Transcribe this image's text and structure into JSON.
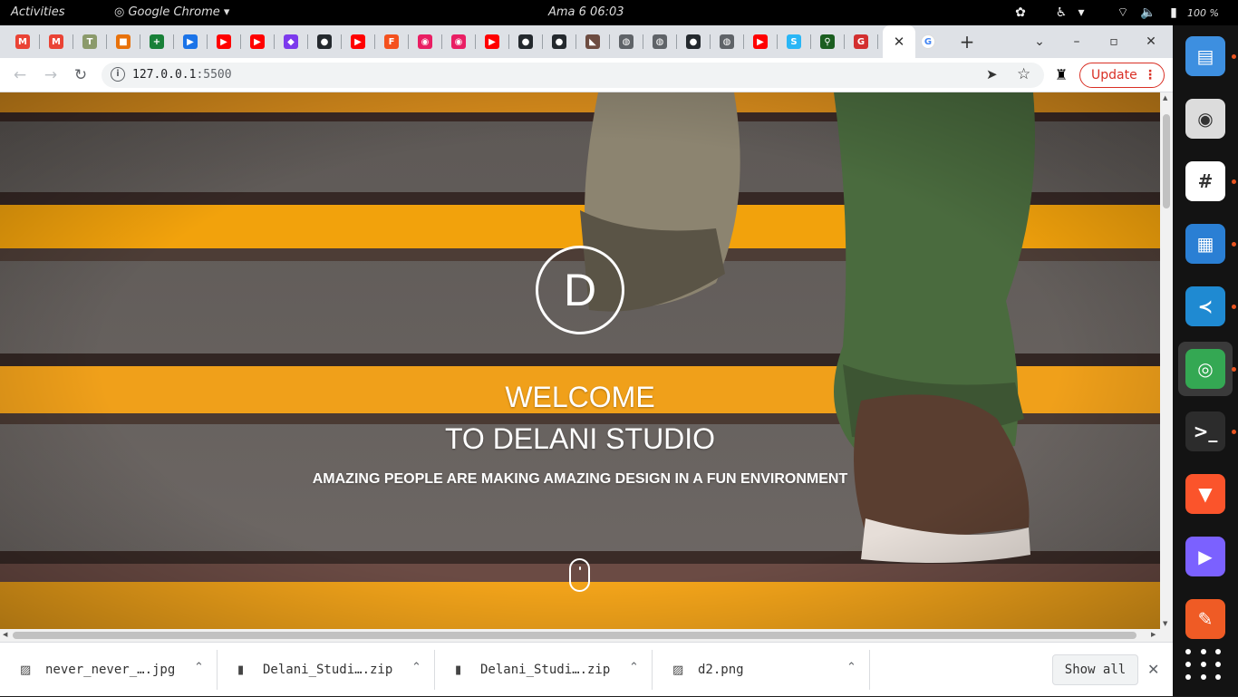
{
  "topbar": {
    "activities": "Activities",
    "app_name": "Google Chrome",
    "clock": "Ama 6 06:03",
    "battery": "100 %"
  },
  "tabs": [
    {
      "icon": "gmail-icon",
      "glyph": "M",
      "color": "#ea4335"
    },
    {
      "icon": "gmail-icon",
      "glyph": "M",
      "color": "#ea4335"
    },
    {
      "icon": "palm-icon",
      "glyph": "T",
      "color": "#8b9a6b"
    },
    {
      "icon": "puzzle-icon",
      "glyph": "■",
      "color": "#e8710a"
    },
    {
      "icon": "sheets-icon",
      "glyph": "+",
      "color": "#188038"
    },
    {
      "icon": "video-player-icon",
      "glyph": "▶",
      "color": "#1a73e8"
    },
    {
      "icon": "youtube-icon",
      "glyph": "▶",
      "color": "#ff0000"
    },
    {
      "icon": "youtube-icon",
      "glyph": "▶",
      "color": "#ff0000"
    },
    {
      "icon": "diamond-icon",
      "glyph": "◆",
      "color": "#7c3aed"
    },
    {
      "icon": "github-icon",
      "glyph": "●",
      "color": "#24292e"
    },
    {
      "icon": "youtube-icon",
      "glyph": "▶",
      "color": "#ff0000"
    },
    {
      "icon": "f-letter-icon",
      "glyph": "F",
      "color": "#f4511e"
    },
    {
      "icon": "play-record-icon",
      "glyph": "◉",
      "color": "#e91e63"
    },
    {
      "icon": "play-record-icon",
      "glyph": "◉",
      "color": "#e91e63"
    },
    {
      "icon": "youtube-icon",
      "glyph": "▶",
      "color": "#ff0000"
    },
    {
      "icon": "github-icon",
      "glyph": "●",
      "color": "#24292e"
    },
    {
      "icon": "github-icon",
      "glyph": "●",
      "color": "#24292e"
    },
    {
      "icon": "africa-map-icon",
      "glyph": "◣",
      "color": "#6d4c41"
    },
    {
      "icon": "globe-icon",
      "glyph": "◍",
      "color": "#5f6368"
    },
    {
      "icon": "globe-icon",
      "glyph": "◍",
      "color": "#5f6368"
    },
    {
      "icon": "github-icon",
      "glyph": "●",
      "color": "#24292e"
    },
    {
      "icon": "globe-icon",
      "glyph": "◍",
      "color": "#5f6368"
    },
    {
      "icon": "youtube-icon",
      "glyph": "▶",
      "color": "#ff0000"
    },
    {
      "icon": "s-letter-icon",
      "glyph": "S",
      "color": "#29b6f6"
    },
    {
      "icon": "runner-icon",
      "glyph": "⚲",
      "color": "#1b5e20"
    },
    {
      "icon": "g-shield-icon",
      "glyph": "G",
      "color": "#d32f2f"
    }
  ],
  "active_tab": {
    "icon": "close-icon",
    "glyph": "✕"
  },
  "google_tab": {
    "icon": "google-icon",
    "glyph": "G"
  },
  "url": {
    "host": "127.0.0.1",
    "port": ":5500"
  },
  "update_button": {
    "label": "Update"
  },
  "hero": {
    "logo_letter": "D",
    "title_line1": "WELCOME",
    "title_line2": "TO DELANI STUDIO",
    "subtitle": "AMAZING PEOPLE ARE MAKING AMAZING DESIGN IN A FUN ENVIRONMENT"
  },
  "downloads": [
    {
      "icon": "image-file-icon",
      "name": "never_never_….jpg"
    },
    {
      "icon": "zip-file-icon",
      "name": "Delani_Studi….zip"
    },
    {
      "icon": "zip-file-icon",
      "name": "Delani_Studi….zip"
    },
    {
      "icon": "image-file-icon",
      "name": "d2.png"
    }
  ],
  "show_all": "Show all",
  "dock": [
    {
      "icon": "files-icon",
      "color": "#3d8fe0",
      "glyph": "▤",
      "running": true
    },
    {
      "icon": "rhythmbox-icon",
      "color": "#dcdcdc",
      "glyph": "◉",
      "running": false
    },
    {
      "icon": "slack-icon",
      "color": "#ffffff",
      "glyph": "#",
      "running": true
    },
    {
      "icon": "libreoffice-impress-icon",
      "color": "#2a7fd4",
      "glyph": "▦",
      "running": true
    },
    {
      "icon": "vscode-icon",
      "color": "#1f8ad2",
      "glyph": "≺",
      "running": true
    },
    {
      "icon": "chrome-icon",
      "color": "#34a853",
      "glyph": "◎",
      "running": true
    },
    {
      "icon": "terminal-icon",
      "color": "#2c2c2c",
      "glyph": ">_",
      "running": true
    },
    {
      "icon": "brave-icon",
      "color": "#fb542b",
      "glyph": "▼",
      "running": false
    },
    {
      "icon": "media-player-icon",
      "color": "#7b61ff",
      "glyph": "▶",
      "running": false
    },
    {
      "icon": "postman-icon",
      "color": "#ef5b25",
      "glyph": "✎",
      "running": false
    }
  ],
  "colors": {
    "accent_red": "#d93025",
    "hero_yellow": "#f2a20c",
    "dock_running_dot": "#e95420"
  }
}
